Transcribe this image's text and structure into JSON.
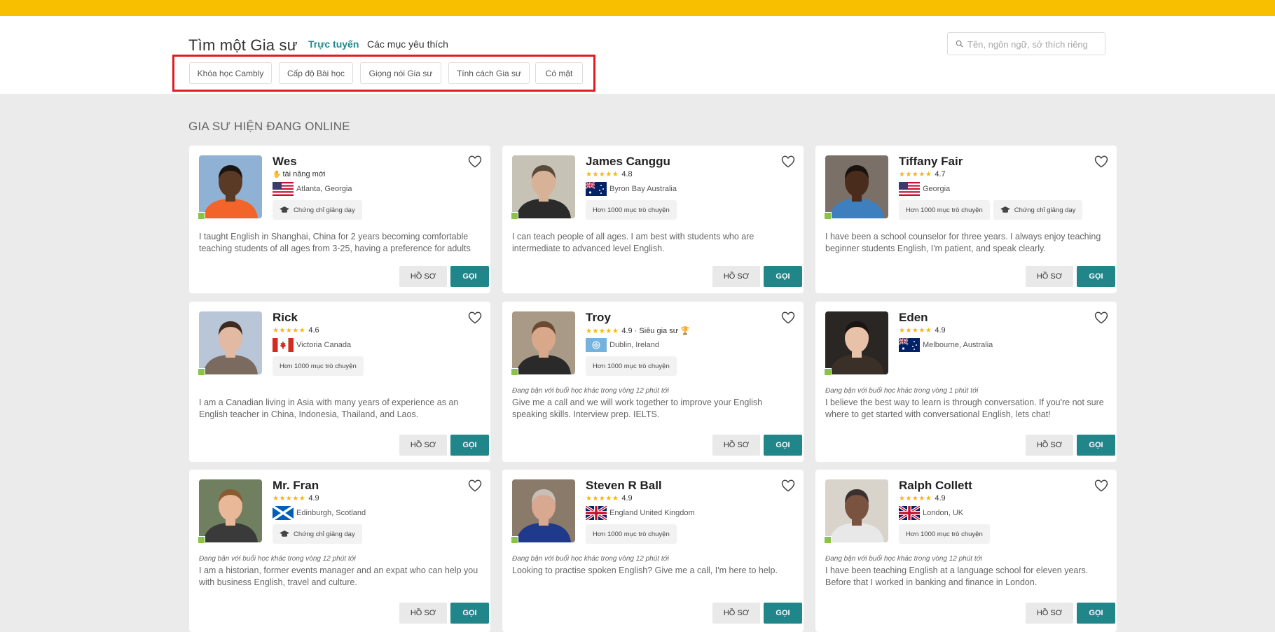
{
  "header": {
    "title": "Tìm một Gia sư",
    "tab_online": "Trực tuyến",
    "tab_favorites": "Các mục yêu thích",
    "search_placeholder": "Tên, ngôn ngữ, sở thích riêng"
  },
  "filters": [
    "Khóa học Cambly",
    "Cấp độ Bài học",
    "Giọng nói Gia sư",
    "Tính cách Gia sư",
    "Có mặt"
  ],
  "section_title": "GIA SƯ HIỆN ĐANG ONLINE",
  "buttons": {
    "profile": "HỒ SƠ",
    "call": "GỌI"
  },
  "tutors": [
    {
      "name": "Wes",
      "new_talent": "tài năng mới",
      "location": "Atlanta, Georgia",
      "flag": "usa-flag-icon",
      "badges": [
        "Chứng chỉ giảng dạy"
      ],
      "busy": "",
      "desc": "I taught English in Shanghai, China for 2 years becoming comfortable teaching students of all ages from 3-25, having a preference for adults",
      "photo": {
        "bg": "#8fb1d4",
        "skin": "#5a3a24",
        "shirt": "#f2642a",
        "hair": "#1b1410"
      }
    },
    {
      "name": "James Canggu",
      "stars": "★★★★★",
      "rating": "4.8",
      "location": "Byron Bay Australia",
      "flag": "australia-flag-icon",
      "badges": [
        "Hơn 1000 mục trò chuyện"
      ],
      "busy": "",
      "desc": "I can teach people of all ages. I am best with students who are intermediate to advanced level English.",
      "photo": {
        "bg": "#c6c2b6",
        "skin": "#d8b296",
        "shirt": "#2b2b2b",
        "hair": "#5a4a3a"
      }
    },
    {
      "name": "Tiffany Fair",
      "stars": "★★★★★",
      "rating": "4.7",
      "location": "Georgia",
      "flag": "usa-flag-icon",
      "badges": [
        "Hơn 1000 mục trò chuyện",
        "Chứng chỉ giảng dạy"
      ],
      "busy": "",
      "desc": "I have been a school counselor for three years. I always enjoy teaching beginner students English, I'm patient, and speak clearly.",
      "photo": {
        "bg": "#7a7068",
        "skin": "#4a2c1c",
        "shirt": "#3e7fc0",
        "hair": "#1a1210"
      }
    },
    {
      "name": "Rick",
      "stars": "★★★★★",
      "rating": "4.6",
      "location": "Victoria Canada",
      "flag": "canada-flag-icon",
      "badges": [
        "Hơn 1000 mục trò chuyện"
      ],
      "busy": "",
      "desc": "I am a Canadian living in Asia with many years of experience as an English teacher in China, Indonesia, Thailand, and Laos.",
      "photo": {
        "bg": "#b8c6d8",
        "skin": "#e2b9a3",
        "shirt": "#7a6a60",
        "hair": "#3d2a20"
      }
    },
    {
      "name": "Troy",
      "stars": "★★★★★",
      "rating": "4.9",
      "super": "· Siêu gia sư",
      "location": "Dublin, Ireland",
      "flag": "un-flag-icon",
      "badges": [
        "Hơn 1000 mục trò chuyện"
      ],
      "busy": "Đang bận với buổi học khác trong vòng 12 phút tới",
      "desc": "Give me a call and we will work together to improve your English speaking skills. Interview prep. IELTS.",
      "photo": {
        "bg": "#a99a88",
        "skin": "#d9a88a",
        "shirt": "#2a2a2a",
        "hair": "#6a4a30"
      }
    },
    {
      "name": "Eden",
      "stars": "★★★★★",
      "rating": "4.9",
      "location": "Melbourne, Australia",
      "flag": "australia-flag-icon",
      "badges": [],
      "busy": "Đang bận với buổi học khác trong vòng 1 phút tới",
      "desc": "I believe the best way to learn is through conversation. If you're not sure where to get started with conversational English, lets chat!",
      "photo": {
        "bg": "#2a2624",
        "skin": "#e8c2a8",
        "shirt": "#3a3028",
        "hair": "#1a1412"
      }
    },
    {
      "name": "Mr. Fran",
      "stars": "★★★★★",
      "rating": "4.9",
      "location": "Edinburgh, Scotland",
      "flag": "scotland-flag-icon",
      "badges": [
        "Chứng chỉ giảng dạy"
      ],
      "busy": "Đang bận với buổi học khác trong vòng 12 phút tới",
      "desc": "I am a historian, former events manager and an expat who can help you with business English, travel and culture.",
      "photo": {
        "bg": "#6f7f60",
        "skin": "#e8b898",
        "shirt": "#3a3a3a",
        "hair": "#8a5a30"
      }
    },
    {
      "name": "Steven R Ball",
      "stars": "★★★★★",
      "rating": "4.9",
      "location": "England United Kingdom",
      "flag": "uk-flag-icon",
      "badges": [
        "Hơn 1000 mục trò chuyện"
      ],
      "busy": "Đang bận với buổi học khác trong vòng 12 phút tới",
      "desc": "Looking to practise spoken English? Give me a call, I'm here to help.",
      "photo": {
        "bg": "#8a7a6a",
        "skin": "#d8a890",
        "shirt": "#1f3a8a",
        "hair": "#c8c0b8"
      }
    },
    {
      "name": "Ralph Collett",
      "stars": "★★★★★",
      "rating": "4.9",
      "location": "London, UK",
      "flag": "uk-flag-icon",
      "badges": [
        "Hơn 1000 mục trò chuyện"
      ],
      "busy": "Đang bận với buổi học khác trong vòng 12 phút tới",
      "desc": "I have been teaching English at a language school for eleven years. Before that I worked in banking and finance in London.",
      "photo": {
        "bg": "#d8d4cc",
        "skin": "#7a5240",
        "shirt": "#e8e8e8",
        "hair": "#3a3030"
      }
    }
  ]
}
